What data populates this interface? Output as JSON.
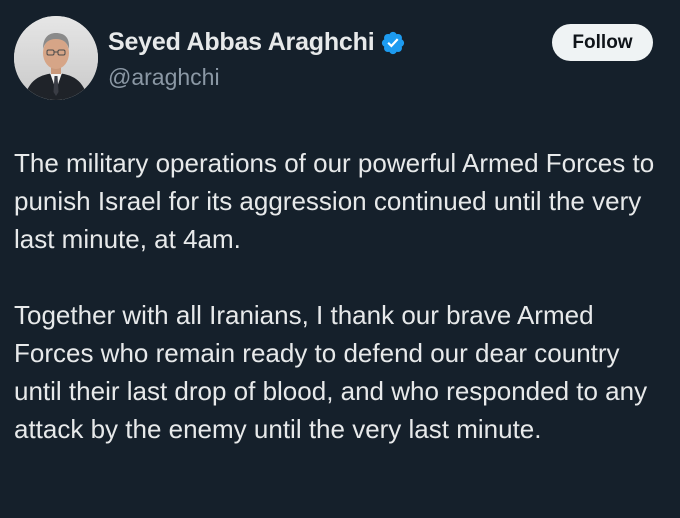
{
  "author": {
    "display_name": "Seyed Abbas Araghchi",
    "handle": "@araghchi",
    "verified": true,
    "avatar_icon": "profile-photo"
  },
  "actions": {
    "follow_label": "Follow"
  },
  "tweet": {
    "paragraphs": [
      "The military operations of our powerful Armed Forces to punish Israel for its aggression continued until the very last minute, at 4am.",
      "Together with all Iranians, I thank our brave Armed Forces who remain ready to defend our dear country until their last drop of blood, and who responded to any attack by the enemy until the very last minute."
    ]
  },
  "colors": {
    "background": "#15202b",
    "text_primary": "#e7e9ea",
    "text_secondary": "#8b98a5",
    "verified_badge": "#1d9bf0",
    "follow_button_bg": "#eff3f4",
    "follow_button_text": "#0f1419"
  }
}
